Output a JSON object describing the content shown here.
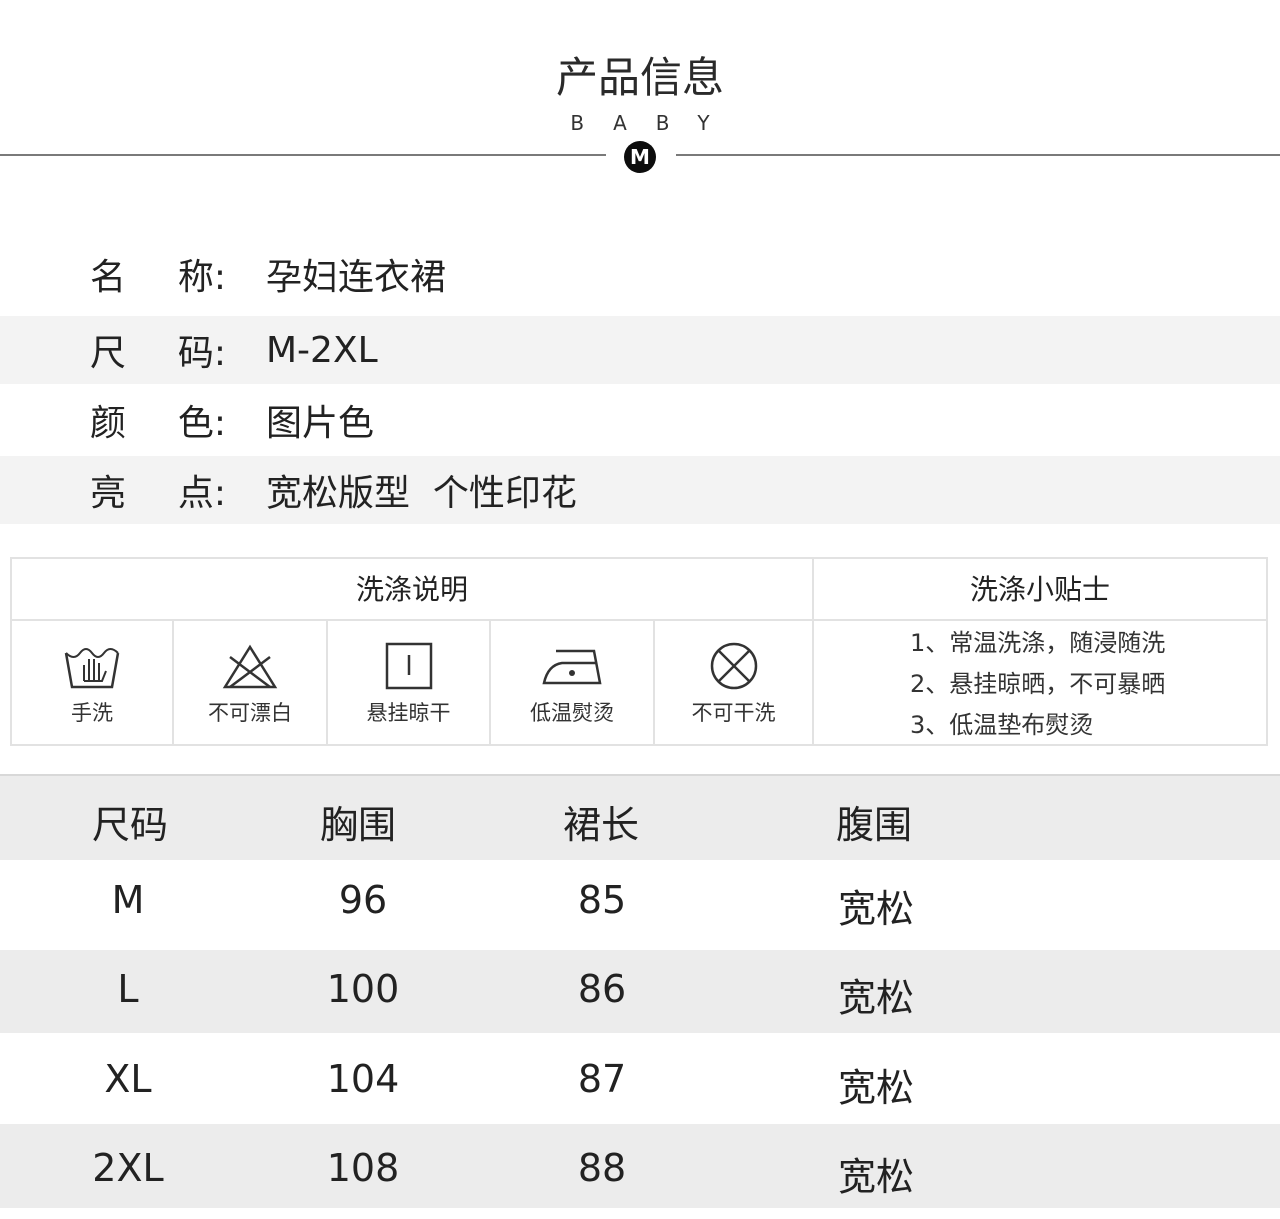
{
  "header": {
    "title": "产品信息",
    "subtitle": "BABY",
    "badge": "M"
  },
  "info": [
    {
      "key_chars": [
        "名",
        "称:"
      ],
      "value": "孕妇连衣裙"
    },
    {
      "key_chars": [
        "尺",
        "码:"
      ],
      "value": "M-2XL"
    },
    {
      "key_chars": [
        "颜",
        "色:"
      ],
      "value": "图片色"
    },
    {
      "key_chars": [
        "亮",
        "点:"
      ],
      "value": "宽松版型  个性印花"
    }
  ],
  "wash": {
    "instructions_title": "洗涤说明",
    "tips_title": "洗涤小贴士",
    "icons": [
      {
        "icon": "hand-wash-icon",
        "label": "手洗"
      },
      {
        "icon": "no-bleach-icon",
        "label": "不可漂白"
      },
      {
        "icon": "hang-dry-icon",
        "label": "悬挂晾干"
      },
      {
        "icon": "low-iron-icon",
        "label": "低温熨烫"
      },
      {
        "icon": "no-dry-clean-icon",
        "label": "不可干洗"
      }
    ],
    "tips": [
      "1、常温洗涤，随浸随洗",
      "2、悬挂晾晒，不可暴晒",
      "3、低温垫布熨烫"
    ]
  },
  "size_table": {
    "headers": [
      "尺码",
      "胸围",
      "裙长",
      "腹围"
    ],
    "rows": [
      [
        "M",
        "96",
        "85",
        "宽松"
      ],
      [
        "L",
        "100",
        "86",
        "宽松"
      ],
      [
        "XL",
        "104",
        "87",
        "宽松"
      ],
      [
        "2XL",
        "108",
        "88",
        "宽松"
      ]
    ]
  }
}
